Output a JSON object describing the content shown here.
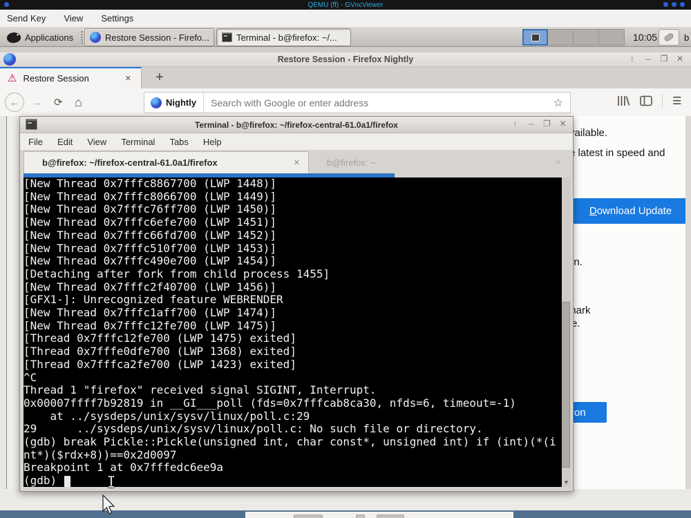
{
  "vnc": {
    "title": "QEMU (ff) - GVncViewer",
    "menu": [
      "Send Key",
      "View",
      "Settings"
    ]
  },
  "taskbar": {
    "applications_label": "Applications",
    "tasks": [
      {
        "label": "Restore Session - Firefo...",
        "icon": "firefox-nightly-icon"
      },
      {
        "label": "Terminal - b@firefox: ~/...",
        "icon": "terminal-icon"
      }
    ],
    "clock": "10:05",
    "user": "b"
  },
  "window_controls": {
    "shade": "↑",
    "minimize": "–",
    "restore": "❐",
    "close": "✕"
  },
  "firefox": {
    "window_title": "Restore Session - Firefox Nightly",
    "tab": {
      "label": "Restore Session",
      "close": "✕",
      "warning_icon": "⚠"
    },
    "new_tab_button": "+",
    "nav": {
      "back": "←",
      "forward": "→",
      "reload": "⟳",
      "home": "⌂",
      "nightly_label": "Nightly",
      "url_placeholder": "Search with Google or enter address",
      "star": "☆",
      "menu_button": "☰"
    },
    "page": {
      "frag_available": "vailable.",
      "frag_speed": "e latest in speed and",
      "download_button_accesskey": "D",
      "download_button_rest": "ownload Update",
      "frag_on": "on.",
      "frag_semi": ";",
      "frag_mark": "tmark",
      "frag_re": "re.",
      "restore_button_frag": "on"
    }
  },
  "terminal": {
    "window_title": "Terminal - b@firefox: ~/firefox-central-61.0a1/firefox",
    "menu": [
      "File",
      "Edit",
      "View",
      "Terminal",
      "Tabs",
      "Help"
    ],
    "tabs": [
      {
        "label": "b@firefox: ~/firefox-central-61.0a1/firefox",
        "close": "✕",
        "active": true
      },
      {
        "label": "b@firefox: ~",
        "close": "✕",
        "active": false
      }
    ],
    "output": [
      "[New Thread 0x7fffc8867700 (LWP 1448)]",
      "[New Thread 0x7fffc8066700 (LWP 1449)]",
      "[New Thread 0x7fffc76ff700 (LWP 1450)]",
      "[New Thread 0x7fffc6efe700 (LWP 1451)]",
      "[New Thread 0x7fffc66fd700 (LWP 1452)]",
      "[New Thread 0x7fffc510f700 (LWP 1453)]",
      "[New Thread 0x7fffc490e700 (LWP 1454)]",
      "[Detaching after fork from child process 1455]",
      "[New Thread 0x7fffc2f40700 (LWP 1456)]",
      "[GFX1-]: Unrecognized feature WEBRENDER",
      "[New Thread 0x7fffc1aff700 (LWP 1474)]",
      "[New Thread 0x7fffc12fe700 (LWP 1475)]",
      "[Thread 0x7fffc12fe700 (LWP 1475) exited]",
      "[Thread 0x7fffe0dfe700 (LWP 1368) exited]",
      "[Thread 0x7fffca2fe700 (LWP 1423) exited]",
      "^C",
      "Thread 1 \"firefox\" received signal SIGINT, Interrupt.",
      "0x00007ffff7b92819 in __GI___poll (fds=0x7fffcab8ca30, nfds=6, timeout=-1)",
      "    at ../sysdeps/unix/sysv/linux/poll.c:29",
      "29      ../sysdeps/unix/sysv/linux/poll.c: No such file or directory.",
      "(gdb) break Pickle::Pickle(unsigned int, char const*, unsigned int) if (int)(*(i",
      "nt*)($rdx+8))==0x2d0097",
      "Breakpoint 1 at 0x7fffedc6ee9a"
    ],
    "prompt": "(gdb) "
  },
  "colors": {
    "primary_button_blue": "#1879e0",
    "tab_accent_blue": "#2a74da",
    "terminal_focus_blue": "#2d74c8",
    "vnc_title_cyan": "#2fa9e8",
    "bottom_bar_slate": "#50708f"
  }
}
